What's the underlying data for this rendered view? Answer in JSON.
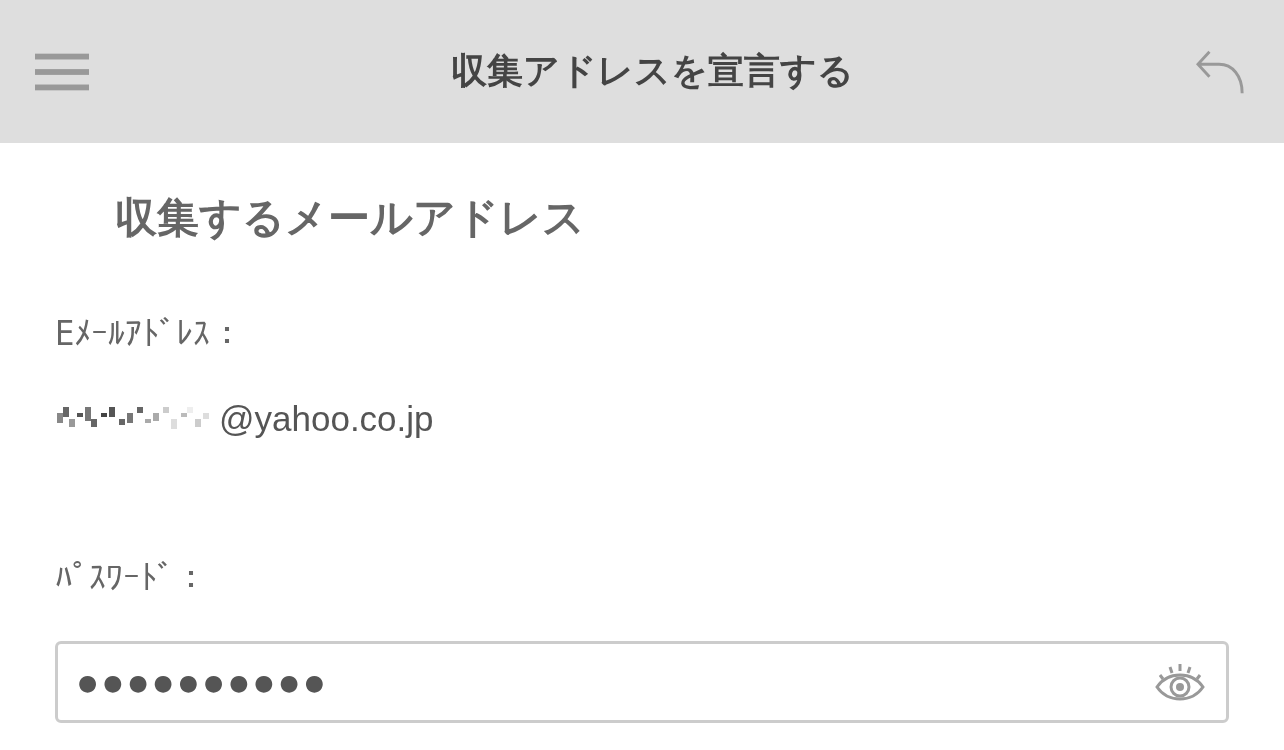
{
  "header": {
    "title": "収集アドレスを宣言する"
  },
  "section": {
    "heading": "収集するメールアドレス"
  },
  "email": {
    "label": "Eﾒｰﾙｱﾄﾞﾚｽ：",
    "value": "@yahoo.co.jp",
    "redacted": true
  },
  "password": {
    "label": "ﾊﾟｽﾜｰﾄﾞ：",
    "value": "●●●●●●●●●●"
  }
}
